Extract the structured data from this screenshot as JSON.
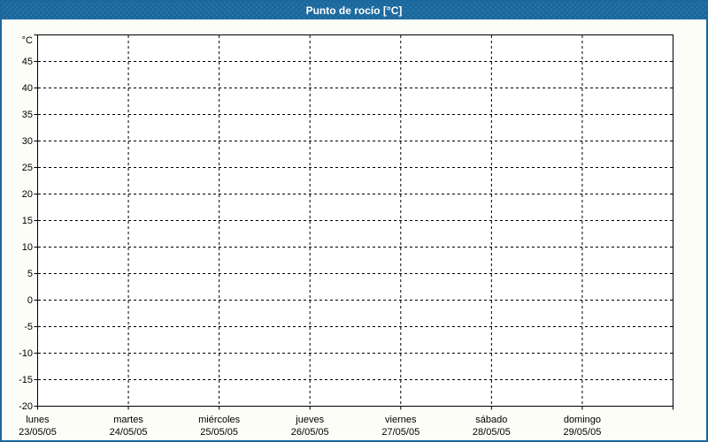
{
  "window": {
    "title": "Punto de rocío [°C]"
  },
  "colors": {
    "titlebar_bg": "#1a689d",
    "window_border": "#1a689d",
    "title_text": "#ffffff",
    "content_bg": "#fcfdf7",
    "plot_bg": "#ffffff",
    "grid": "#000000",
    "axis": "#000000",
    "label_text": "#000000"
  },
  "chart_data": {
    "type": "line",
    "title": "Punto de rocío [°C]",
    "series": [],
    "grid": true,
    "legend_visible": false,
    "y_axis": {
      "unit_label": "°C",
      "min": -20,
      "max": 50,
      "tick_step": 5,
      "tick_labels": [
        "45",
        "40",
        "35",
        "30",
        "25",
        "20",
        "15",
        "10",
        "5",
        "0",
        "-5",
        "-10",
        "-15",
        "-20"
      ]
    },
    "x_categories": [
      {
        "day": "lunes",
        "date": "23/05/05"
      },
      {
        "day": "martes",
        "date": "24/05/05"
      },
      {
        "day": "miércoles",
        "date": "25/05/05"
      },
      {
        "day": "jueves",
        "date": "26/05/05"
      },
      {
        "day": "viernes",
        "date": "27/05/05"
      },
      {
        "day": "sábado",
        "date": "28/05/05"
      },
      {
        "day": "domingo",
        "date": "29/05/05"
      }
    ]
  }
}
